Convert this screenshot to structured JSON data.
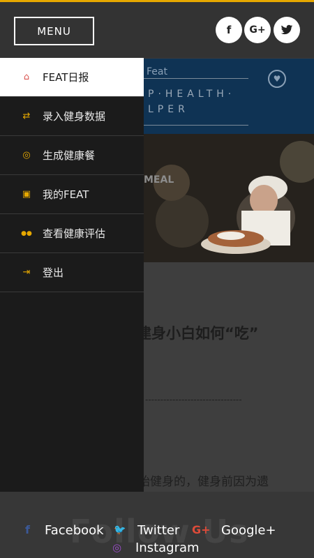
{
  "topbar": {
    "menu_label": "MENU",
    "social": [
      {
        "name": "facebook",
        "glyph": "f"
      },
      {
        "name": "google-plus",
        "glyph": "G+"
      },
      {
        "name": "twitter",
        "glyph": "🐦"
      }
    ]
  },
  "background": {
    "header_title": "Feat",
    "slogan_line1": "P·HEALTH·",
    "slogan_line2": "LPER",
    "hero_label": "MEAL",
    "article_title": "建身小白如何“吃”",
    "dashes": "--------------------------------",
    "paragraph": "始健身的，健身前因为遗"
  },
  "drawer": {
    "items": [
      {
        "label": "FEAT日报",
        "icon": "home-icon",
        "glyph": "⌂",
        "active": true
      },
      {
        "label": "录入健身数据",
        "icon": "shuffle-icon",
        "glyph": "⇄",
        "active": false
      },
      {
        "label": "生成健康餐",
        "icon": "compass-icon",
        "glyph": "◎",
        "active": false
      },
      {
        "label": "我的FEAT",
        "icon": "image-icon",
        "glyph": "▣",
        "active": false
      },
      {
        "label": "查看健康评估",
        "icon": "users-icon",
        "glyph": "●●",
        "active": false
      },
      {
        "label": "登出",
        "icon": "sign-in-icon",
        "glyph": "⇥",
        "active": false
      }
    ]
  },
  "footer": {
    "watermark": "Follow Us",
    "links": [
      {
        "label": "Facebook",
        "icon": "facebook-icon"
      },
      {
        "label": "Twitter",
        "icon": "twitter-icon"
      },
      {
        "label": "Google+",
        "icon": "google-plus-icon"
      },
      {
        "label": "Instagram",
        "icon": "instagram-icon"
      }
    ]
  },
  "colors": {
    "accent": "#e6a800",
    "active_icon": "#d9534f",
    "drawer_bg": "#1b1b1b",
    "header_blue": "#0f3354"
  }
}
